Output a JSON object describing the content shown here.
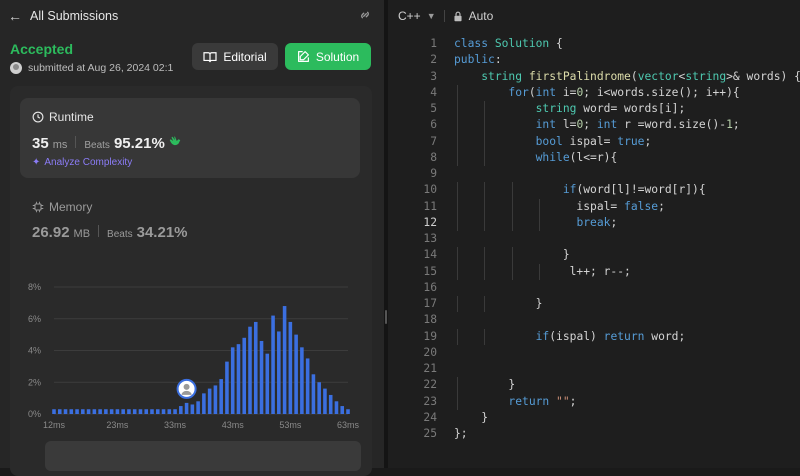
{
  "header": {
    "back_label": "All Submissions"
  },
  "submission": {
    "status": "Accepted",
    "submitted": "submitted at Aug 26, 2024 02:1",
    "editorial_label": "Editorial",
    "solution_label": "Solution"
  },
  "runtime": {
    "title": "Runtime",
    "value": "35",
    "unit": "ms",
    "beats_label": "Beats",
    "beats": "95.21%",
    "analyze_label": "Analyze Complexity"
  },
  "memory": {
    "title": "Memory",
    "value": "26.92",
    "unit": "MB",
    "beats_label": "Beats",
    "beats": "34.21%"
  },
  "chart_data": {
    "type": "bar",
    "yticks": [
      "8%",
      "6%",
      "4%",
      "2%",
      "0%"
    ],
    "ylim": [
      0,
      8
    ],
    "xlim": [
      12,
      63
    ],
    "xticks": [
      "12ms",
      "23ms",
      "33ms",
      "43ms",
      "53ms",
      "63ms"
    ],
    "x": [
      12,
      13,
      14,
      15,
      16,
      17,
      18,
      19,
      20,
      21,
      22,
      23,
      24,
      25,
      26,
      27,
      28,
      29,
      30,
      31,
      32,
      33,
      34,
      35,
      36,
      37,
      38,
      39,
      40,
      41,
      42,
      43,
      44,
      45,
      46,
      47,
      48,
      49,
      50,
      51,
      52,
      53,
      54,
      55,
      56,
      57,
      58,
      59,
      60,
      61,
      62,
      63
    ],
    "values": [
      0.3,
      0.3,
      0.3,
      0.3,
      0.3,
      0.3,
      0.3,
      0.3,
      0.3,
      0.3,
      0.3,
      0.3,
      0.3,
      0.3,
      0.3,
      0.3,
      0.3,
      0.3,
      0.3,
      0.3,
      0.3,
      0.3,
      0.5,
      0.7,
      0.6,
      0.8,
      1.3,
      1.6,
      1.8,
      2.2,
      3.3,
      4.2,
      4.4,
      4.8,
      5.5,
      5.8,
      4.6,
      3.8,
      6.2,
      5.2,
      6.8,
      5.8,
      5.0,
      4.2,
      3.5,
      2.5,
      2.0,
      1.6,
      1.2,
      0.8,
      0.5,
      0.3
    ],
    "highlight_x": 35,
    "bar_color": "#3b6fe0"
  },
  "editor": {
    "language": "C++",
    "mode": "Auto",
    "current_line": 12,
    "lines": [
      "class Solution {",
      "public:",
      "    string firstPalindrome(vector<string>& words) {",
      "        for(int i=0; i<words.size(); i++){",
      "            string word= words[i];",
      "            int l=0; int r =word.size()-1;",
      "            bool ispal= true;",
      "            while(l<=r){",
      "",
      "                if(word[l]!=word[r]){",
      "                  ispal= false;",
      "                  break;",
      "",
      "                }",
      "                 l++; r--;",
      "",
      "            }",
      "",
      "            if(ispal) return word;",
      "",
      "",
      "        }",
      "        return \"\";",
      "    }",
      "};"
    ]
  },
  "colors": {
    "accepted": "#2cbb5d",
    "solution_button": "#2cbb5d",
    "analyze": "#8b7cf6"
  }
}
